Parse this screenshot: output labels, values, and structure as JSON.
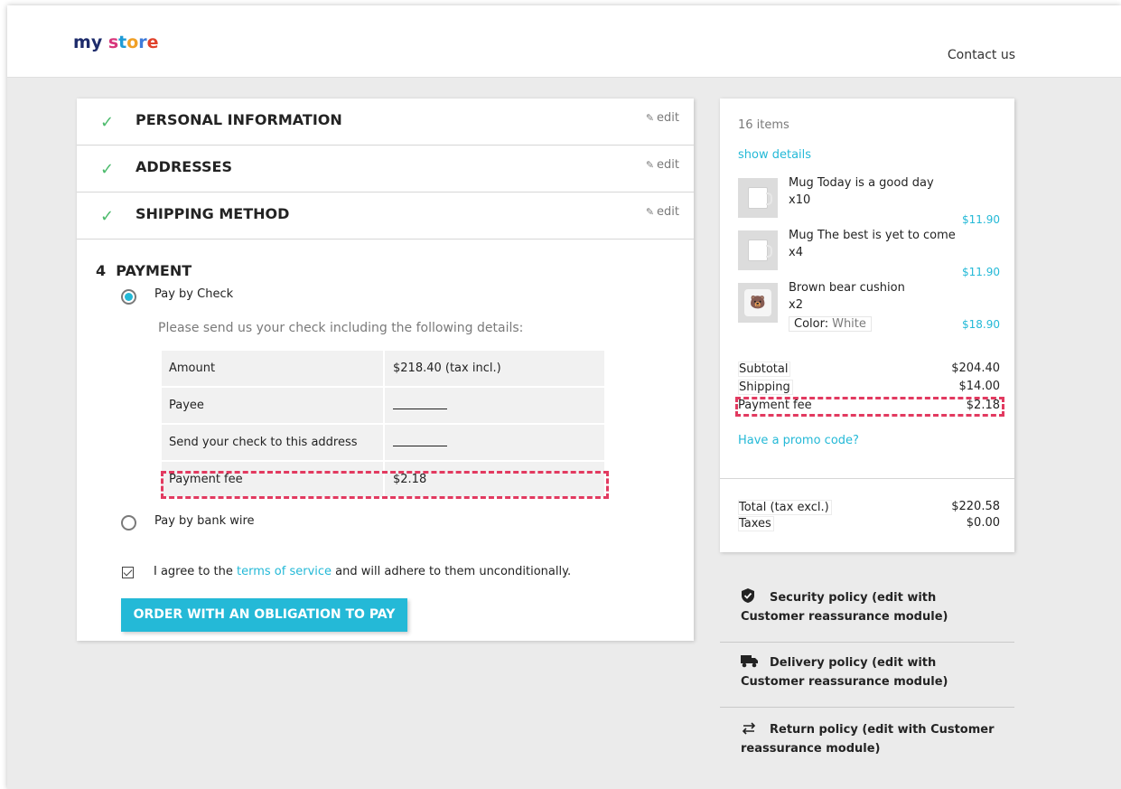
{
  "header": {
    "logo_letters": [
      {
        "ch": "m",
        "color": "#1e2c6b"
      },
      {
        "ch": "y",
        "color": "#1e2c6b"
      },
      {
        "ch": " ",
        "color": "#1e2c6b"
      },
      {
        "ch": "s",
        "color": "#d8367b"
      },
      {
        "ch": "t",
        "color": "#1e9bd6"
      },
      {
        "ch": "o",
        "color": "#f0a026"
      },
      {
        "ch": "r",
        "color": "#3f7bd9"
      },
      {
        "ch": "e",
        "color": "#e0412b"
      }
    ],
    "contact": "Contact us"
  },
  "steps": [
    {
      "title": "PERSONAL INFORMATION",
      "edit": "edit"
    },
    {
      "title": "ADDRESSES",
      "edit": "edit"
    },
    {
      "title": "SHIPPING METHOD",
      "edit": "edit"
    }
  ],
  "payment": {
    "title": "4  PAYMENT",
    "option_check": "Pay by Check",
    "description": "Please send us your check including the following details:",
    "rows": [
      {
        "label": "Amount",
        "value": "$218.40 (tax incl.)"
      },
      {
        "label": "Payee",
        "value": ""
      },
      {
        "label": "Send your check to this address",
        "value": ""
      },
      {
        "label": "Payment fee",
        "value": "$2.18"
      }
    ],
    "option_wire": "Pay by bank wire",
    "agree_prefix": "I agree to the ",
    "agree_link": "terms of service",
    "agree_suffix": " and will adhere to them unconditionally.",
    "order_button": "ORDER WITH AN OBLIGATION TO PAY"
  },
  "summary": {
    "items_count": "16 items",
    "show_details": "show details",
    "products": [
      {
        "name": "Mug Today is a good day",
        "qty": "x10",
        "price": "$11.90"
      },
      {
        "name": "Mug The best is yet to come",
        "qty": "x4",
        "price": "$11.90"
      },
      {
        "name": "Brown bear cushion",
        "qty": "x2",
        "attr_label": "Color:",
        "attr_value": "White",
        "price": "$18.90"
      }
    ],
    "subtotal_label": "Subtotal",
    "subtotal_value": "$204.40",
    "shipping_label": "Shipping",
    "shipping_value": "$14.00",
    "fee_label": "Payment fee",
    "fee_value": "$2.18",
    "promo": "Have a promo code?",
    "total_label": "Total (tax excl.)",
    "total_value": "$220.58",
    "taxes_label": "Taxes",
    "taxes_value": "$0.00"
  },
  "reassurance": [
    {
      "line1": "Security policy (edit with",
      "line2": "Customer reassurance module)",
      "icon": "shield-icon"
    },
    {
      "line1": "Delivery policy (edit with",
      "line2": "Customer reassurance module)",
      "icon": "truck-icon"
    },
    {
      "line1": "Return policy (edit with Customer",
      "line2": "reassurance module)",
      "icon": "exchange-arrows-icon"
    }
  ],
  "colors": {
    "accent": "#24b9d7",
    "check": "#4cbb6c",
    "highlight": "#e23a60"
  }
}
